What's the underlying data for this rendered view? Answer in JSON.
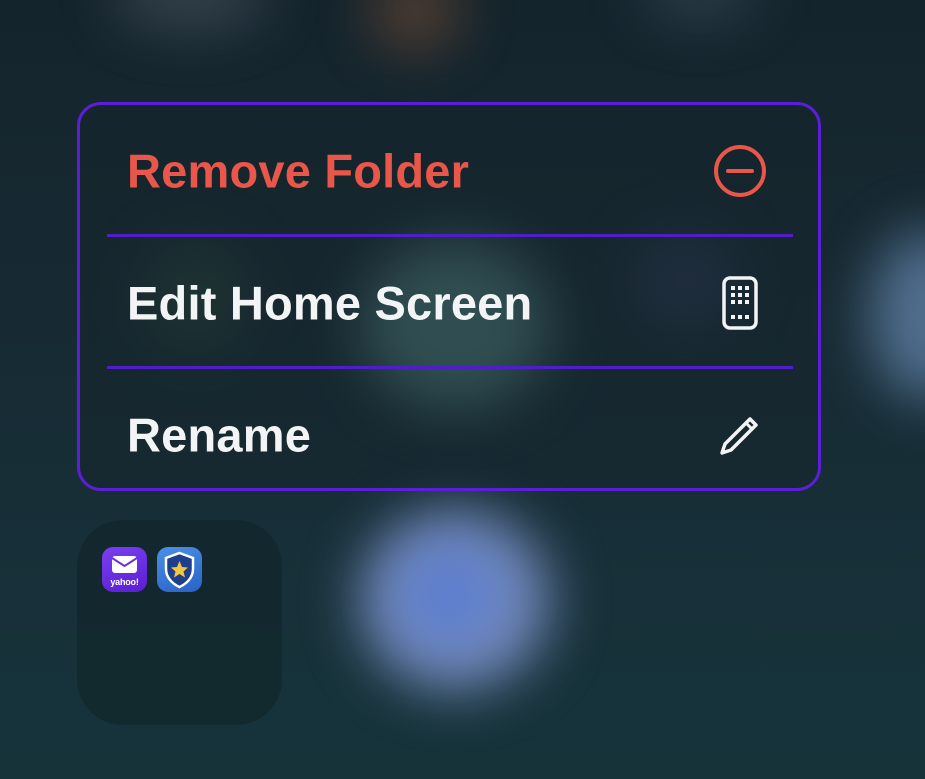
{
  "context_menu": {
    "items": [
      {
        "label": "Remove Folder",
        "icon": "minus-circle-icon",
        "destructive": true
      },
      {
        "label": "Edit Home Screen",
        "icon": "phone-apps-icon",
        "destructive": false
      },
      {
        "label": "Rename",
        "icon": "pencil-icon",
        "destructive": false
      }
    ],
    "accent_color": "#5a1fd6",
    "destructive_color": "#e8574a"
  },
  "folder": {
    "apps": [
      {
        "icon": "yahoo-mail-app-icon",
        "text": "yahoo!"
      },
      {
        "icon": "shield-star-app-icon"
      }
    ]
  }
}
